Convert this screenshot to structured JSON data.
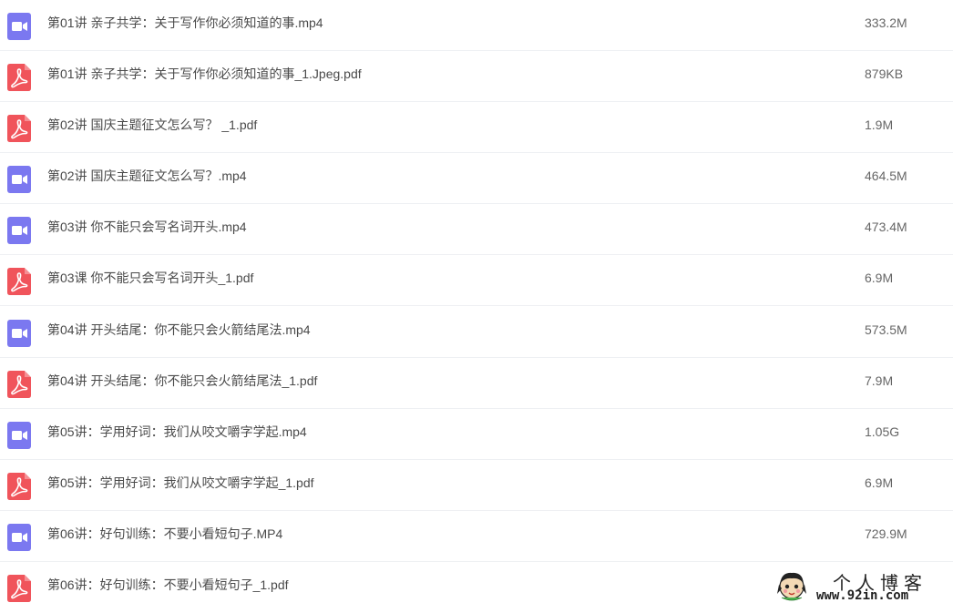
{
  "colors": {
    "video_icon": "#7b78f0",
    "pdf_icon": "#f0545b",
    "text": "#4a4a4a",
    "size_text": "#666666",
    "row_divider": "#eef0f3"
  },
  "files": [
    {
      "type": "video",
      "icon": "video-icon",
      "name": "第01讲 亲子共学：关于写作你必须知道的事.mp4",
      "size": "333.2M"
    },
    {
      "type": "pdf",
      "icon": "pdf-icon",
      "name": "第01讲 亲子共学：关于写作你必须知道的事_1.Jpeg.pdf",
      "size": "879KB"
    },
    {
      "type": "pdf",
      "icon": "pdf-icon",
      "name": "第02讲 国庆主题征文怎么写？ _1.pdf",
      "size": "1.9M"
    },
    {
      "type": "video",
      "icon": "video-icon",
      "name": "第02讲 国庆主题征文怎么写？.mp4",
      "size": "464.5M"
    },
    {
      "type": "video",
      "icon": "video-icon",
      "name": "第03讲 你不能只会写名词开头.mp4",
      "size": "473.4M"
    },
    {
      "type": "pdf",
      "icon": "pdf-icon",
      "name": "第03课 你不能只会写名词开头_1.pdf",
      "size": "6.9M"
    },
    {
      "type": "video",
      "icon": "video-icon",
      "name": "第04讲 开头结尾：你不能只会火箭结尾法.mp4",
      "size": "573.5M"
    },
    {
      "type": "pdf",
      "icon": "pdf-icon",
      "name": "第04讲 开头结尾：你不能只会火箭结尾法_1.pdf",
      "size": "7.9M"
    },
    {
      "type": "video",
      "icon": "video-icon",
      "name": "第05讲：学用好词：我们从咬文嚼字学起.mp4",
      "size": "1.05G"
    },
    {
      "type": "pdf",
      "icon": "pdf-icon",
      "name": "第05讲：学用好词：我们从咬文嚼字学起_1.pdf",
      "size": "6.9M"
    },
    {
      "type": "video",
      "icon": "video-icon",
      "name": "第06讲：好句训练：不要小看短句子.MP4",
      "size": "729.9M"
    },
    {
      "type": "pdf",
      "icon": "pdf-icon",
      "name": "第06讲：好句训练：不要小看短句子_1.pdf",
      "size": ""
    }
  ],
  "watermark": {
    "title": "个人博客",
    "url": "www.92in.com"
  }
}
